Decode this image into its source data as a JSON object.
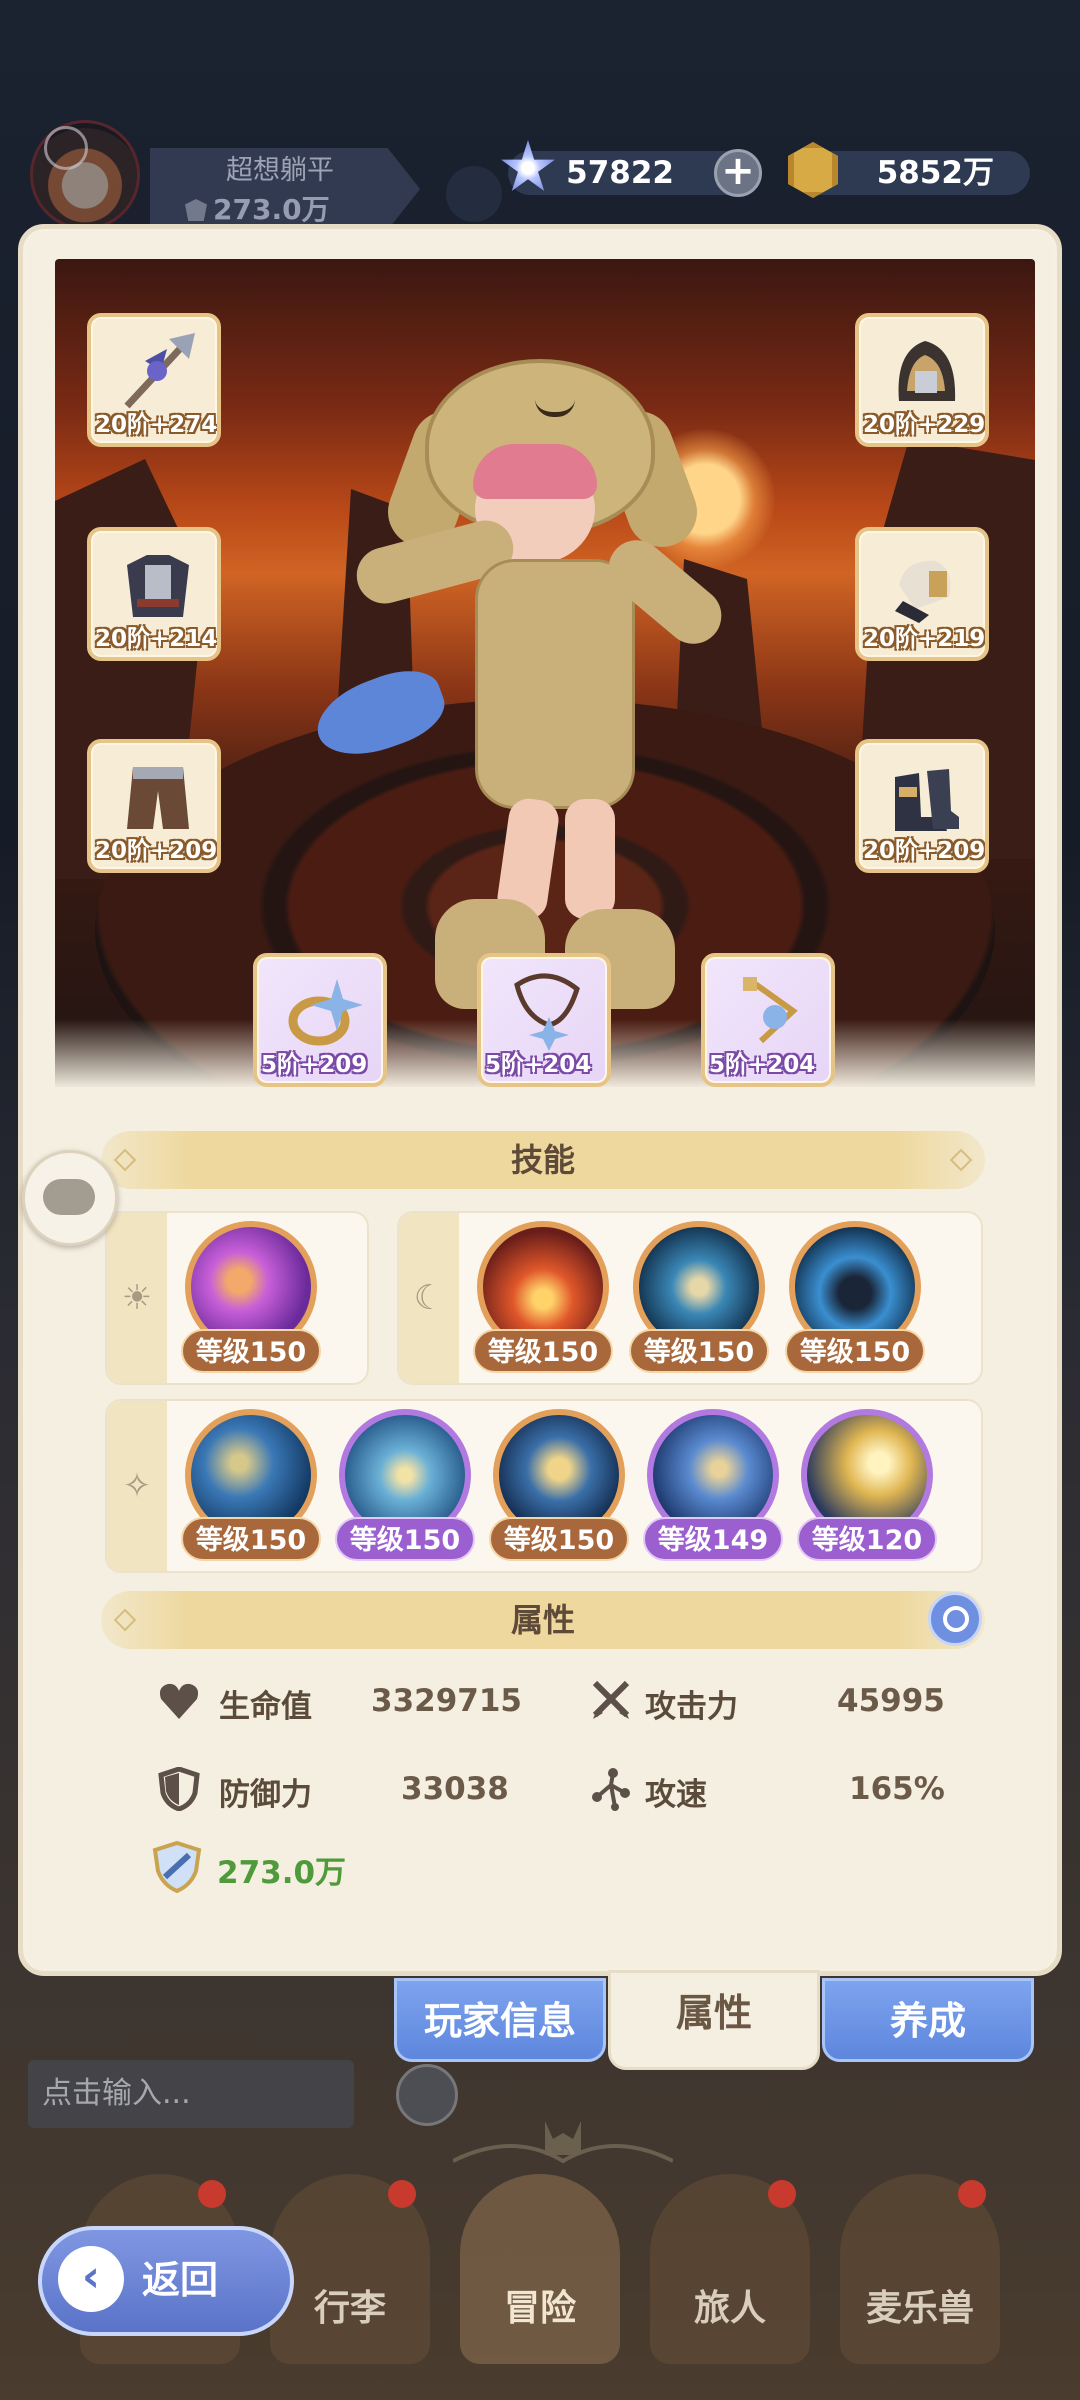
{
  "player": {
    "name": "超想躺平",
    "power": "273.0万"
  },
  "currency": {
    "stars": "57822",
    "coins": "5852万",
    "plus_label": "+"
  },
  "equipment": [
    {
      "slot": "weapon",
      "level": "20阶+274",
      "icon": "spear-icon"
    },
    {
      "slot": "helmet",
      "level": "20阶+229",
      "icon": "helmet-icon"
    },
    {
      "slot": "armor",
      "level": "20阶+214",
      "icon": "armor-icon"
    },
    {
      "slot": "gloves",
      "level": "20阶+219",
      "icon": "gloves-icon"
    },
    {
      "slot": "pants",
      "level": "20阶+209",
      "icon": "pants-icon"
    },
    {
      "slot": "boots",
      "level": "20阶+209",
      "icon": "boots-icon"
    }
  ],
  "accessories": [
    {
      "slot": "ring",
      "level": "5阶+209",
      "icon": "ring-icon"
    },
    {
      "slot": "necklace",
      "level": "5阶+204",
      "icon": "necklace-icon"
    },
    {
      "slot": "pendant",
      "level": "5阶+204",
      "icon": "pendant-icon"
    }
  ],
  "skills_section": {
    "title": "技能",
    "group_sun": {
      "icon": "sun-icon",
      "symbol": "☀",
      "skills": [
        {
          "level": "等级150",
          "rarity": "gold",
          "color": "#a646d6"
        }
      ]
    },
    "group_moon": {
      "icon": "moon-icon",
      "symbol": "☾",
      "skills": [
        {
          "level": "等级150",
          "rarity": "gold",
          "color": "#c7452a"
        },
        {
          "level": "等级150",
          "rarity": "gold",
          "color": "#2e6b9c"
        },
        {
          "level": "等级150",
          "rarity": "gold",
          "color": "#2a5a8a"
        }
      ]
    },
    "group_star": {
      "icon": "sparkle-icon",
      "symbol": "✧",
      "skills": [
        {
          "level": "等级150",
          "rarity": "gold",
          "color": "#2f5e93"
        },
        {
          "level": "等级150",
          "rarity": "purple",
          "color": "#3a78a8"
        },
        {
          "level": "等级150",
          "rarity": "gold",
          "color": "#2c5d8c"
        },
        {
          "level": "等级149",
          "rarity": "purple",
          "color": "#3e6fb0"
        },
        {
          "level": "等级120",
          "rarity": "purple",
          "color": "#c8a040"
        }
      ]
    }
  },
  "attributes_section": {
    "title": "属性",
    "hp": {
      "label": "生命值",
      "value": "3329715"
    },
    "attack": {
      "label": "攻击力",
      "value": "45995"
    },
    "defense": {
      "label": "防御力",
      "value": "33038"
    },
    "speed": {
      "label": "攻速",
      "value": "165%"
    },
    "power": "273.0万"
  },
  "tabs": [
    {
      "label": "玩家信息",
      "active": false
    },
    {
      "label": "属性",
      "active": true
    },
    {
      "label": "养成",
      "active": false
    }
  ],
  "chat": {
    "placeholder": "点击输入..."
  },
  "nav": [
    {
      "label": "行李"
    },
    {
      "label": "冒险"
    },
    {
      "label": "旅人"
    },
    {
      "label": "麦乐兽"
    }
  ],
  "back_label": "返回",
  "colors": {
    "accent_blue": "#6f8fe0",
    "gold_border": "#e3a05a",
    "purple_border": "#b27ae0",
    "power_green": "#4f9a3a"
  }
}
